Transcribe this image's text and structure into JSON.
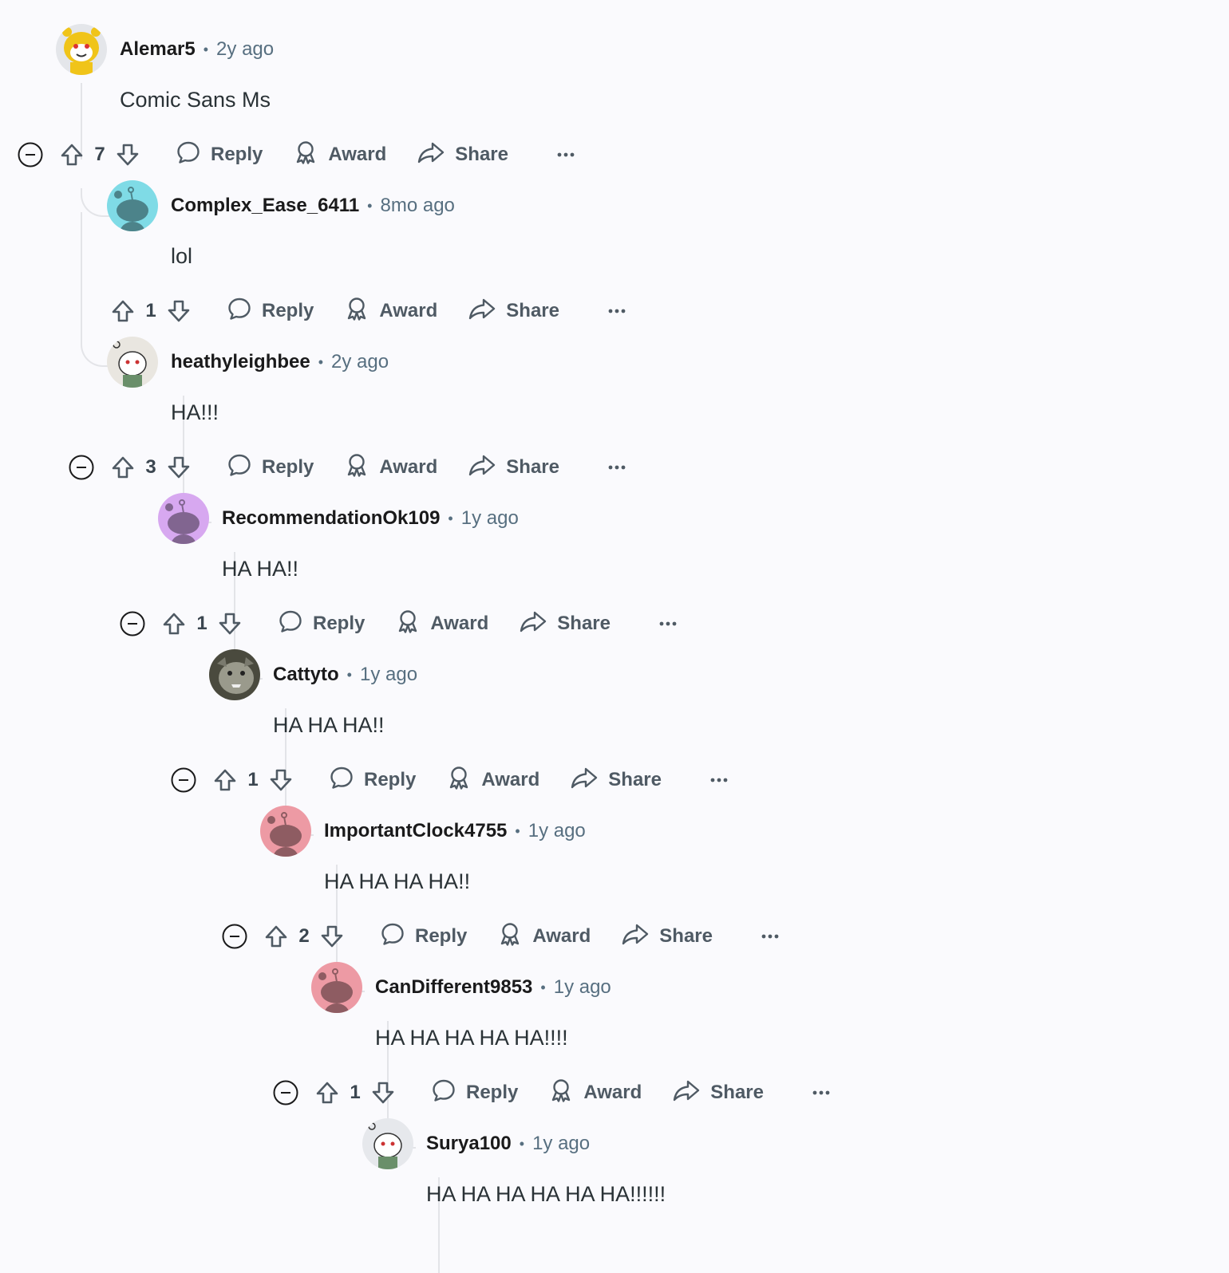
{
  "comments": [
    {
      "username": "Alemar5",
      "separator": "•",
      "time": "2y ago",
      "text": "Comic Sans Ms",
      "score": "7",
      "reply": "Reply",
      "award": "Award",
      "share": "Share",
      "avatar": "tiger-mascot-avatar",
      "avatar_color": "#f0c419"
    },
    {
      "username": "Complex_Ease_6411",
      "separator": "•",
      "time": "8mo ago",
      "text": "lol",
      "score": "1",
      "reply": "Reply",
      "award": "Award",
      "share": "Share",
      "avatar": "default-snoo-avatar",
      "avatar_color": "#7fdbe6"
    },
    {
      "username": "heathyleighbee",
      "separator": "•",
      "time": "2y ago",
      "text": "HA!!!",
      "score": "3",
      "reply": "Reply",
      "award": "Award",
      "share": "Share",
      "avatar": "custom-snoo-avatar",
      "avatar_color": "#e9e6e0"
    },
    {
      "username": "RecommendationOk109",
      "separator": "•",
      "time": "1y ago",
      "text": "HA HA!!",
      "score": "1",
      "reply": "Reply",
      "award": "Award",
      "share": "Share",
      "avatar": "default-snoo-avatar",
      "avatar_color": "#d7a8f0"
    },
    {
      "username": "Cattyto",
      "separator": "•",
      "time": "1y ago",
      "text": "HA HA HA!!",
      "score": "1",
      "reply": "Reply",
      "award": "Award",
      "share": "Share",
      "avatar": "cat-photo-avatar",
      "avatar_color": "#4a4a3e"
    },
    {
      "username": "ImportantClock4755",
      "separator": "•",
      "time": "1y ago",
      "text": "HA HA HA HA!!",
      "score": "2",
      "reply": "Reply",
      "award": "Award",
      "share": "Share",
      "avatar": "default-snoo-avatar",
      "avatar_color": "#ed9aa4"
    },
    {
      "username": "CanDifferent9853",
      "separator": "•",
      "time": "1y ago",
      "text": "HA HA HA HA HA!!!!",
      "score": "1",
      "reply": "Reply",
      "award": "Award",
      "share": "Share",
      "avatar": "default-snoo-avatar",
      "avatar_color": "#ed9aa4"
    },
    {
      "username": "Surya100",
      "separator": "•",
      "time": "1y ago",
      "text": "HA HA HA HA HA HA!!!!!!",
      "avatar": "custom-snoo-avatar",
      "avatar_color": "#e6e8ec"
    }
  ],
  "icons": {
    "collapse": "collapse-icon",
    "upvote": "upvote-arrow-icon",
    "downvote": "downvote-arrow-icon",
    "reply": "speech-bubble-icon",
    "award": "award-ribbon-icon",
    "share": "share-arrow-icon",
    "more": "ellipsis-icon"
  },
  "colors": {
    "background": "#fafafd",
    "thread_line": "#e3e4e8",
    "meta_text": "#576f80",
    "action_text": "#4f5a64"
  }
}
